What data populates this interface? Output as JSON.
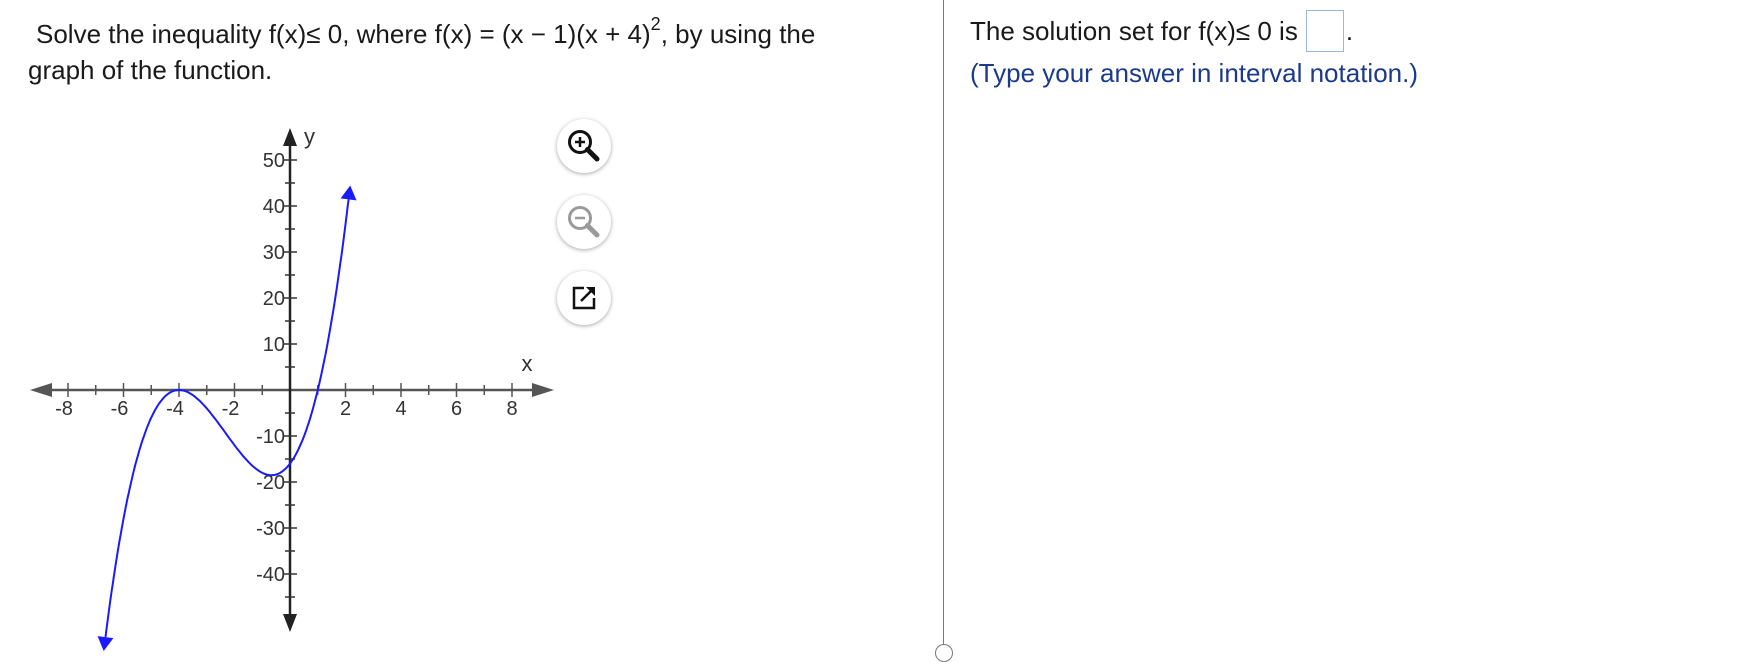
{
  "question": {
    "line1_before_sup": "Solve the inequality f(x)≤ 0, where f(x) = (x − 1)(x + 4)",
    "line1_sup": "2",
    "line1_after_sup": ", by using the",
    "line2": "graph of the function."
  },
  "answer": {
    "prompt": "The solution set for f(x)≤ 0 is",
    "trailing": ".",
    "hint": "(Type your answer in interval notation.)"
  },
  "graph": {
    "x_axis_label": "x",
    "y_axis_label": "y",
    "x_tick_labels": [
      "-8",
      "-6",
      "-4",
      "-2",
      "2",
      "4",
      "6",
      "8"
    ],
    "y_tick_labels": [
      "50",
      "40",
      "30",
      "20",
      "10",
      "-10",
      "-20",
      "-30",
      "-40"
    ],
    "curve_color": "#1a1aff"
  },
  "tools": {
    "zoom_in_icon": "zoom-in-icon",
    "zoom_out_icon": "zoom-out-icon",
    "popout_icon": "external-link-icon"
  }
}
